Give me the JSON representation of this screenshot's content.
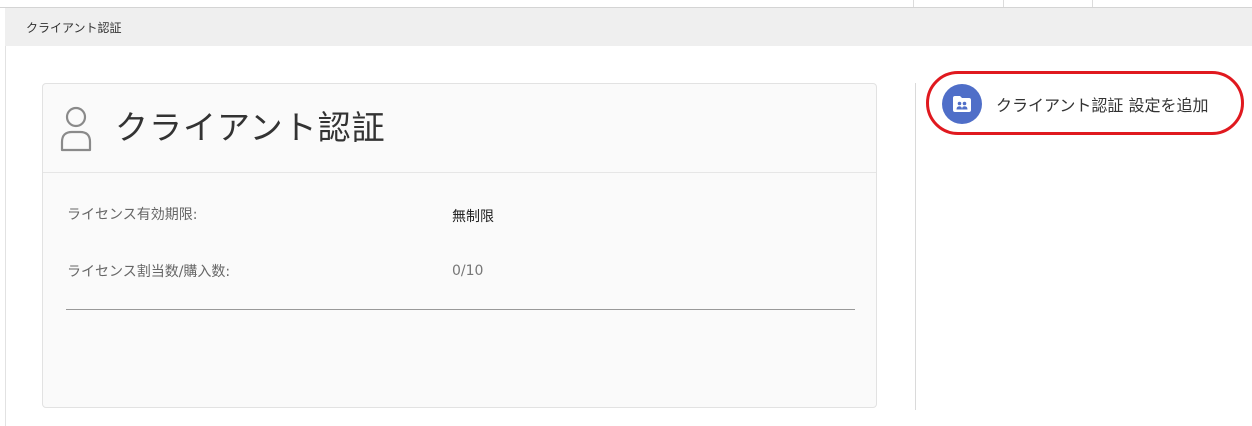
{
  "breadcrumb": {
    "current": "クライアント認証"
  },
  "card": {
    "title": "クライアント認証",
    "icon": "user-icon",
    "rows": [
      {
        "label": "ライセンス有効期限:",
        "value": "無制限"
      },
      {
        "label": "ライセンス割当数/購入数:",
        "value": "0/10"
      }
    ]
  },
  "actions": {
    "add_setting": {
      "label": "クライアント認証 設定を追加",
      "icon": "folder-users-icon"
    }
  },
  "colors": {
    "accent": "#4f6ec8",
    "highlight": "#e0191f",
    "breadcrumb_bg": "#efefef"
  }
}
